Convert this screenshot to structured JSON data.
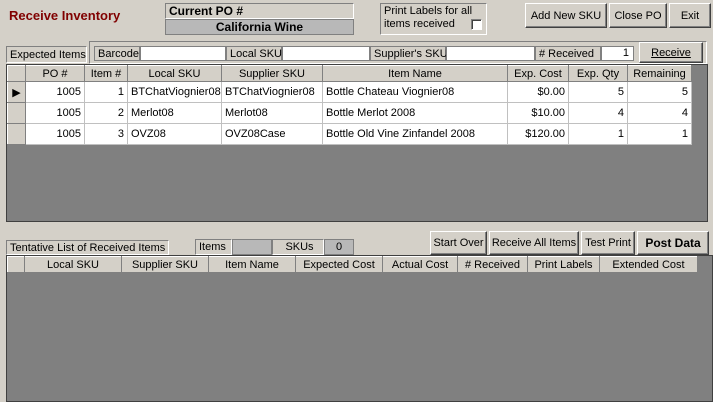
{
  "title": "Receive Inventory",
  "current_po": {
    "label": "Current PO #",
    "value": "California Wine"
  },
  "print_labels": {
    "label": "Print Labels for all items received",
    "checked": false
  },
  "buttons": {
    "add_new_sku": "Add New SKU",
    "close_po": "Close PO",
    "exit": "Exit",
    "receive": "Receive",
    "start_over": "Start Over",
    "receive_all": "Receive All Items",
    "test_print": "Test Print",
    "post_data": "Post Data"
  },
  "expected": {
    "tab_label": "Expected Items",
    "barcode_label": "Barcode",
    "barcode_value": "",
    "local_sku_label": "Local SKU",
    "local_sku_value": "",
    "supplier_sku_label": "Supplier's SKU",
    "supplier_sku_value": "",
    "received_label": "# Received",
    "received_value": "1",
    "columns": [
      "PO #",
      "Item #",
      "Local SKU",
      "Supplier SKU",
      "Item Name",
      "Exp. Cost",
      "Exp. Qty",
      "Remaining"
    ],
    "rows": [
      {
        "indicator": "▶",
        "po": "1005",
        "item": "1",
        "local_sku": "BTChatViognier08",
        "supplier_sku": "BTChatViognier08",
        "name": "Bottle Chateau Viognier08",
        "cost": "$0.00",
        "qty": "5",
        "remaining": "5"
      },
      {
        "indicator": "",
        "po": "1005",
        "item": "2",
        "local_sku": "Merlot08",
        "supplier_sku": "Merlot08",
        "name": "Bottle Merlot 2008",
        "cost": "$10.00",
        "qty": "4",
        "remaining": "4"
      },
      {
        "indicator": "",
        "po": "1005",
        "item": "3",
        "local_sku": "OVZ08",
        "supplier_sku": "OVZ08Case",
        "name": "Bottle Old Vine Zinfandel 2008",
        "cost": "$120.00",
        "qty": "1",
        "remaining": "1"
      }
    ]
  },
  "tentative": {
    "tab_label": "Tentative List of Received Items",
    "items_label": "Items",
    "items_value": "",
    "skus_label": "SKUs",
    "skus_value": "0",
    "columns": [
      "Local SKU",
      "Supplier SKU",
      "Item Name",
      "Expected Cost",
      "Actual Cost",
      "# Received",
      "Print Labels",
      "Extended Cost"
    ]
  }
}
